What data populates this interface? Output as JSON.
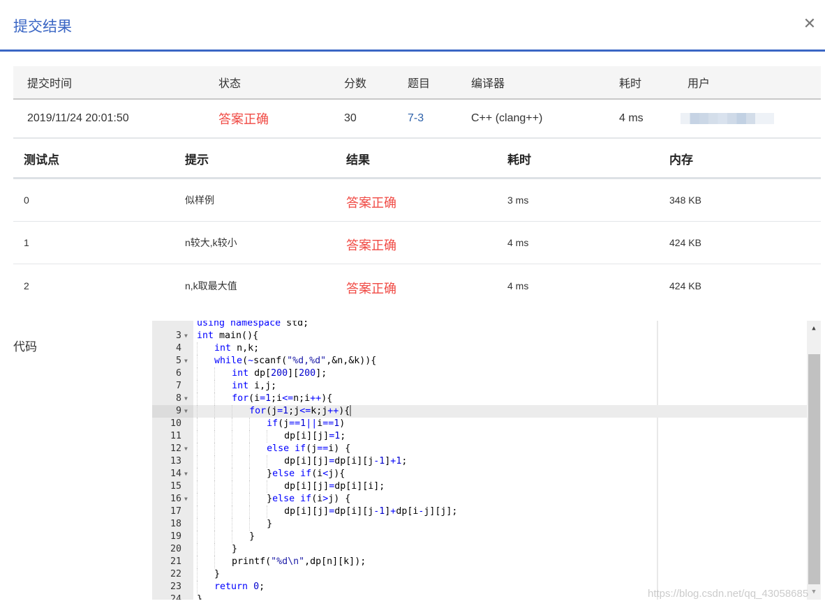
{
  "modal": {
    "title": "提交结果",
    "close_icon": "close-icon",
    "accent_color": "#3a66c4"
  },
  "summary": {
    "headers": [
      "提交时间",
      "状态",
      "分数",
      "题目",
      "编译器",
      "耗时",
      "用户"
    ],
    "row": {
      "submit_time": "2019/11/24 20:01:50",
      "status": "答案正确",
      "score": "30",
      "problem": "7-3",
      "compiler": "C++ (clang++)",
      "time": "4 ms",
      "user": ""
    },
    "status_color": "#f04a44"
  },
  "tests": {
    "headers": [
      "测试点",
      "提示",
      "结果",
      "耗时",
      "内存"
    ],
    "rows": [
      {
        "id": "0",
        "hint": "似样例",
        "result": "答案正确",
        "time": "3 ms",
        "memory": "348 KB"
      },
      {
        "id": "1",
        "hint": "n较大,k较小",
        "result": "答案正确",
        "time": "4 ms",
        "memory": "424 KB"
      },
      {
        "id": "2",
        "hint": "n,k取最大值",
        "result": "答案正确",
        "time": "4 ms",
        "memory": "424 KB"
      }
    ]
  },
  "code": {
    "label": "代码",
    "active_line": 9,
    "lines": [
      {
        "n": "",
        "fold": false,
        "text": ""
      },
      {
        "n": "3",
        "fold": true
      },
      {
        "n": "4",
        "fold": false
      },
      {
        "n": "5",
        "fold": true
      },
      {
        "n": "6",
        "fold": false
      },
      {
        "n": "7",
        "fold": false
      },
      {
        "n": "8",
        "fold": true
      },
      {
        "n": "9",
        "fold": true
      },
      {
        "n": "10",
        "fold": false
      },
      {
        "n": "11",
        "fold": false
      },
      {
        "n": "12",
        "fold": true
      },
      {
        "n": "13",
        "fold": false
      },
      {
        "n": "14",
        "fold": true
      },
      {
        "n": "15",
        "fold": false
      },
      {
        "n": "16",
        "fold": true
      },
      {
        "n": "17",
        "fold": false
      },
      {
        "n": "18",
        "fold": false
      },
      {
        "n": "19",
        "fold": false
      },
      {
        "n": "20",
        "fold": false
      },
      {
        "n": "21",
        "fold": false
      },
      {
        "n": "22",
        "fold": false
      },
      {
        "n": "23",
        "fold": false
      },
      {
        "n": "24",
        "fold": false
      }
    ],
    "source": [
      "using namespace std;",
      "int main(){",
      "    int n,k;",
      "    while(~scanf(\"%d,%d\",&n,&k)){",
      "        int dp[200][200];",
      "        int i,j;",
      "        for(i=1;i<=n;i++){",
      "            for(j=1;j<=k;j++){",
      "                if(j==1||i==1)",
      "                    dp[i][j]=1;",
      "                else if(j==i) {",
      "                    dp[i][j]=dp[i][j-1]+1;",
      "                }else if(i<j){",
      "                    dp[i][j]=dp[i][i];",
      "                }else if(i>j) {",
      "                    dp[i][j]=dp[i][j-1]+dp[i-j][j];",
      "                }",
      "            }",
      "        }",
      "        printf(\"%d\\n\",dp[n][k]);",
      "    }",
      "    return 0;",
      "}"
    ]
  },
  "watermark": "https://blog.csdn.net/qq_43058685"
}
